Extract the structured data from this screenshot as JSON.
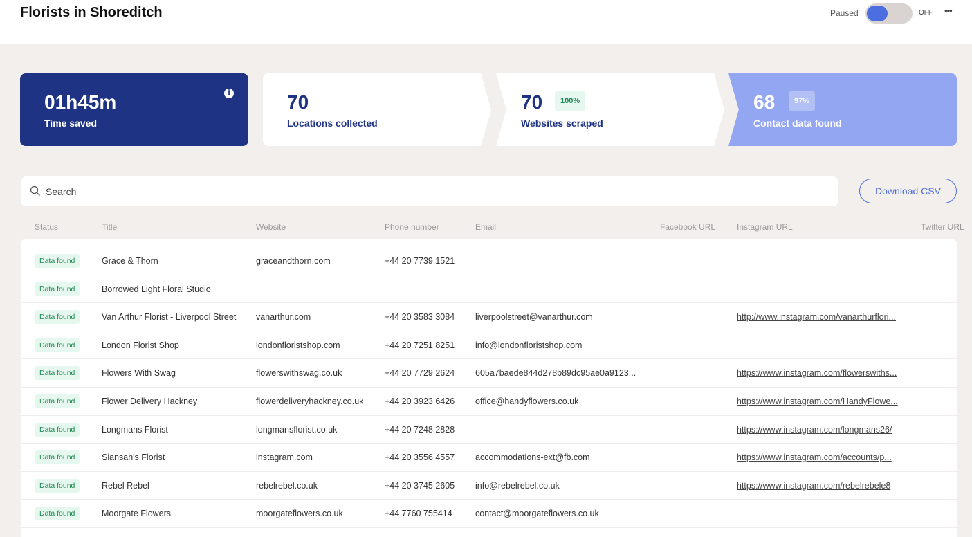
{
  "header": {
    "title": "Florists in Shoreditch",
    "status_label": "Paused",
    "toggle_state": "OFF",
    "toggle_on": false,
    "more_icon": "ellipsis-icon"
  },
  "stats": [
    {
      "value": "01h45m",
      "label": "Time saved",
      "icon": "info-icon"
    },
    {
      "value": "70",
      "label": "Locations collected"
    },
    {
      "value": "70",
      "label": "Websites scraped",
      "percent": "100%"
    },
    {
      "value": "68",
      "label": "Contact data found",
      "percent": "97%"
    }
  ],
  "colors": {
    "primary": "#1f3384",
    "accent": "#4b6fe0",
    "contact_card": "#93a6f1",
    "badge_bg": "#e6f7ef",
    "badge_text": "#1e8a53"
  },
  "search": {
    "placeholder": "Search",
    "value": ""
  },
  "download_label": "Download CSV",
  "table": {
    "columns": [
      "Status",
      "Title",
      "Website",
      "Phone number",
      "Email",
      "Facebook URL",
      "Instagram URL",
      "Twitter URL"
    ],
    "rows": [
      {
        "status": "Data found",
        "title": "Grace & Thorn",
        "website": "graceandthorn.com",
        "phone": "+44 20 7739 1521",
        "email": "",
        "facebook": "",
        "instagram": ""
      },
      {
        "status": "Data found",
        "title": "Borrowed Light Floral Studio",
        "website": "",
        "phone": "",
        "email": "",
        "facebook": "",
        "instagram": ""
      },
      {
        "status": "Data found",
        "title": "Van Arthur Florist - Liverpool Street",
        "website": "vanarthur.com",
        "phone": "+44 20 3583 3084",
        "email": "liverpoolstreet@vanarthur.com",
        "facebook": "",
        "instagram": "http://www.instagram.com/vanarthurflori..."
      },
      {
        "status": "Data found",
        "title": "London Florist Shop",
        "website": "londonfloristshop.com",
        "phone": "+44 20 7251 8251",
        "email": "info@londonfloristshop.com",
        "facebook": "",
        "instagram": ""
      },
      {
        "status": "Data found",
        "title": "Flowers With Swag",
        "website": "flowerswithswag.co.uk",
        "phone": "+44 20 7729 2624",
        "email": "605a7baede844d278b89dc95ae0a9123...",
        "facebook": "",
        "instagram": "https://www.instagram.com/flowerswiths..."
      },
      {
        "status": "Data found",
        "title": "Flower Delivery Hackney",
        "website": "flowerdeliveryhackney.co.uk",
        "phone": "+44 20 3923 6426",
        "email": "office@handyflowers.co.uk",
        "facebook": "",
        "instagram": "https://www.instagram.com/HandyFlowe..."
      },
      {
        "status": "Data found",
        "title": "Longmans Florist",
        "website": "longmansflorist.co.uk",
        "phone": "+44 20 7248 2828",
        "email": "",
        "facebook": "",
        "instagram": "https://www.instagram.com/longmans26/"
      },
      {
        "status": "Data found",
        "title": "Siansah's Florist",
        "website": "instagram.com",
        "phone": "+44 20 3556 4557",
        "email": "accommodations-ext@fb.com",
        "facebook": "",
        "instagram": "https://www.instagram.com/accounts/p..."
      },
      {
        "status": "Data found",
        "title": "Rebel Rebel",
        "website": "rebelrebel.co.uk",
        "phone": "+44 20 3745 2605",
        "email": "info@rebelrebel.co.uk",
        "facebook": "",
        "instagram": "https://www.instagram.com/rebelrebele8"
      },
      {
        "status": "Data found",
        "title": "Moorgate Flowers",
        "website": "moorgateflowers.co.uk",
        "phone": "+44 7760 755414",
        "email": "contact@moorgateflowers.co.uk",
        "facebook": "",
        "instagram": ""
      }
    ]
  }
}
